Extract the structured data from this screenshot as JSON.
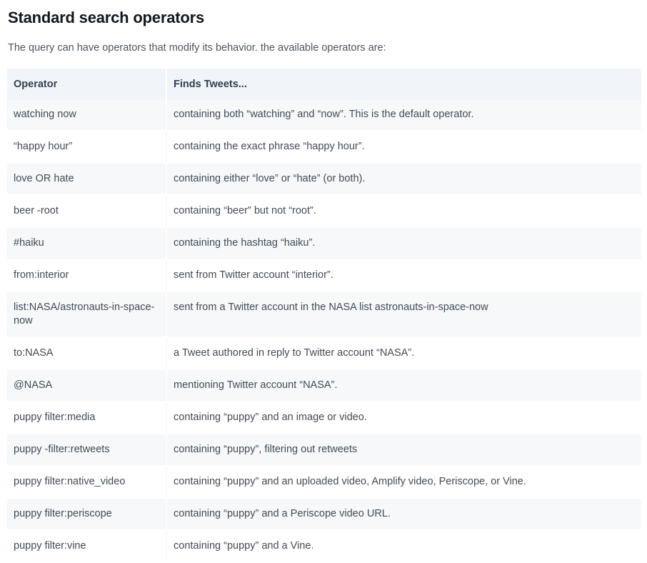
{
  "page": {
    "title": "Standard search operators",
    "intro": "The query can have operators that modify its behavior. the available operators are:"
  },
  "table": {
    "headers": {
      "operator": "Operator",
      "finds": "Finds Tweets..."
    },
    "rows": [
      {
        "operator": "watching now",
        "description": "containing both “watching” and “now”. This is the default operator."
      },
      {
        "operator": "“happy hour”",
        "description": "containing the exact phrase “happy hour”."
      },
      {
        "operator": "love OR hate",
        "description": "containing either “love” or “hate” (or both)."
      },
      {
        "operator": "beer -root",
        "description": "containing “beer” but not “root”."
      },
      {
        "operator": "#haiku",
        "description": "containing the hashtag “haiku”."
      },
      {
        "operator": "from:interior",
        "description": "sent from Twitter account “interior”."
      },
      {
        "operator": "list:NASA/astronauts-in-space-now",
        "description": "sent from a Twitter account in the NASA list astronauts-in-space-now"
      },
      {
        "operator": "to:NASA",
        "description": "a Tweet authored in reply to Twitter account “NASA”."
      },
      {
        "operator": "@NASA",
        "description": "mentioning Twitter account “NASA”."
      },
      {
        "operator": "puppy filter:media",
        "description": "containing “puppy” and an image or video."
      },
      {
        "operator": "puppy -filter:retweets",
        "description": "containing “puppy”, filtering out retweets"
      },
      {
        "operator": "puppy filter:native_video",
        "description": "containing “puppy” and an uploaded video, Amplify video, Periscope, or Vine."
      },
      {
        "operator": "puppy filter:periscope",
        "description": "containing “puppy” and a Periscope video URL."
      },
      {
        "operator": "puppy filter:vine",
        "description": "containing “puppy” and a Vine."
      }
    ]
  },
  "colors": {
    "header_bg": "#f1f4f8",
    "row_stripe": "#f6f8f9",
    "title_text": "#11181f",
    "body_text": "#414c57"
  }
}
